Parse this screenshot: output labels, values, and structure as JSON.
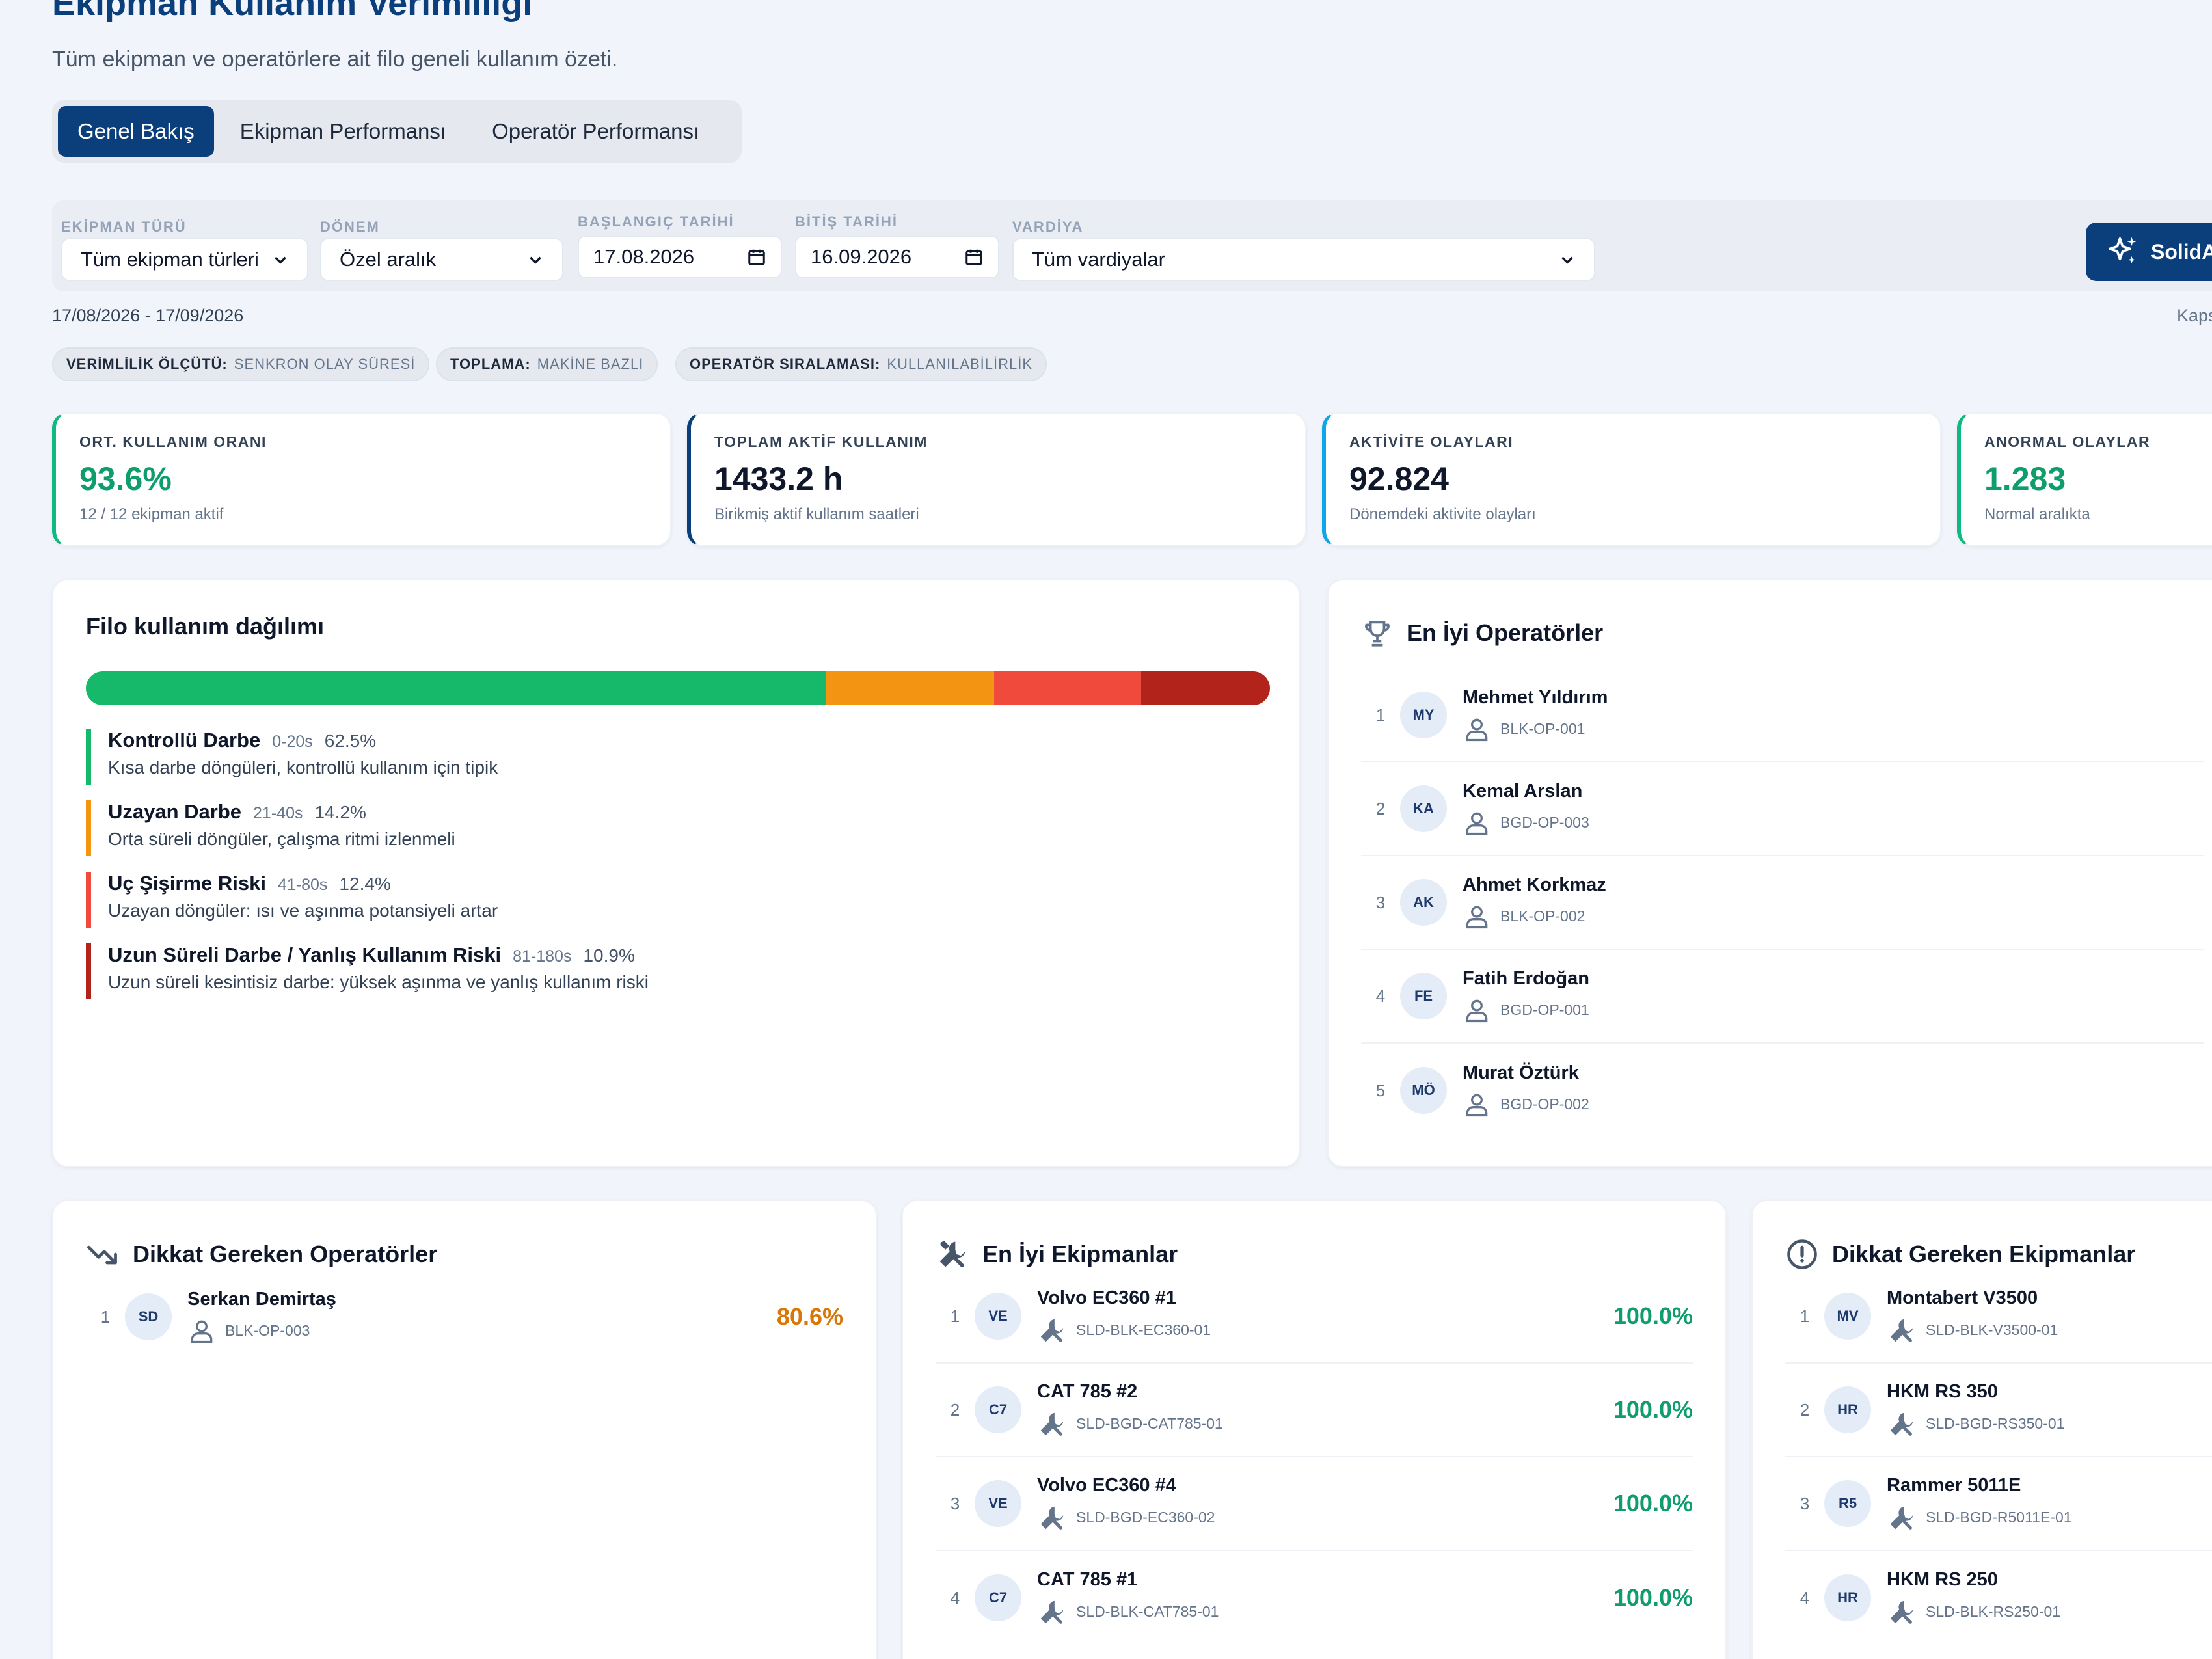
{
  "header": {
    "title": "Ekipman Kullanım Verimliliği",
    "subtitle": "Tüm ekipman ve operatörlere ait filo geneli kullanım özeti."
  },
  "tabs": [
    "Genel Bakış",
    "Ekipman Performansı",
    "Operatör Performansı"
  ],
  "filters": {
    "equipment_type": {
      "label": "EKİPMAN TÜRÜ",
      "value": "Tüm ekipman türleri"
    },
    "period": {
      "label": "DÖNEM",
      "value": "Özel aralık"
    },
    "start_date": {
      "label": "BAŞLANGIÇ TARİHİ",
      "value": "17.08.2026"
    },
    "end_date": {
      "label": "BİTİŞ TARİHİ",
      "value": "16.09.2026"
    },
    "shift": {
      "label": "VARDİYA",
      "value": "Tüm vardiyalar"
    },
    "ai_button": "SolidA"
  },
  "date_range": "17/08/2026 - 17/09/2026",
  "kaps_text": "Kaps",
  "chips": [
    {
      "key": "VERİMLİLİK ÖLÇÜTÜ:",
      "value": "SENKRON OLAY SÜRESİ"
    },
    {
      "key": "TOPLAMA:",
      "value": "MAKİNE BAZLI"
    },
    {
      "key": "OPERATÖR SIRALAMASI:",
      "value": "KULLANILABİLİRLİK"
    }
  ],
  "kpis": [
    {
      "label": "ORT. KULLANIM ORANI",
      "value": "93.6%",
      "sub": "12 / 12 ekipman aktif",
      "color": "#0f9d6b",
      "border": "#10b981"
    },
    {
      "label": "TOPLAM AKTİF KULLANIM",
      "value": "1433.2 h",
      "sub": "Birikmiş aktif kullanım saatleri",
      "color": "#0f172a",
      "border": "#0b3f7c"
    },
    {
      "label": "AKTİVİTE OLAYLARI",
      "value": "92.824",
      "sub": "Dönemdeki aktivite olayları",
      "color": "#0f172a",
      "border": "#0ea5e9"
    },
    {
      "label": "ANORMAL OLAYLAR",
      "value": "1.283",
      "sub": "Normal aralıkta",
      "color": "#0f9d6b",
      "border": "#10b981"
    }
  ],
  "distribution": {
    "title": "Filo kullanım dağılımı",
    "segments": [
      {
        "name": "Kontrollü Darbe",
        "range": "0-20s",
        "percent": "62.5%",
        "share": 62.5,
        "color": "#16b86a",
        "desc": "Kısa darbe döngüleri, kontrollü kullanım için tipik"
      },
      {
        "name": "Uzayan Darbe",
        "range": "21-40s",
        "percent": "14.2%",
        "share": 14.2,
        "color": "#f39412",
        "desc": "Orta süreli döngüler, çalışma ritmi izlenmeli"
      },
      {
        "name": "Uç Şişirme Riski",
        "range": "41-80s",
        "percent": "12.4%",
        "share": 12.4,
        "color": "#ef4a3c",
        "desc": "Uzayan döngüler: ısı ve aşınma potansiyeli artar"
      },
      {
        "name": "Uzun Süreli Darbe / Yanlış Kullanım Riski",
        "range": "81-180s",
        "percent": "10.9%",
        "share": 10.9,
        "color": "#b2231c",
        "desc": "Uzun süreli kesintisiz darbe: yüksek aşınma ve yanlış kullanım riski"
      }
    ]
  },
  "top_operators": {
    "title": "En İyi Operatörler",
    "items": [
      {
        "rank": "1",
        "initials": "MY",
        "name": "Mehmet Yıldırım",
        "code": "BLK-OP-001"
      },
      {
        "rank": "2",
        "initials": "KA",
        "name": "Kemal Arslan",
        "code": "BGD-OP-003"
      },
      {
        "rank": "3",
        "initials": "AK",
        "name": "Ahmet Korkmaz",
        "code": "BLK-OP-002"
      },
      {
        "rank": "4",
        "initials": "FE",
        "name": "Fatih Erdoğan",
        "code": "BGD-OP-001"
      },
      {
        "rank": "5",
        "initials": "MÖ",
        "name": "Murat Öztürk",
        "code": "BGD-OP-002"
      }
    ]
  },
  "attention_operators": {
    "title": "Dikkat Gereken Operatörler",
    "items": [
      {
        "rank": "1",
        "initials": "SD",
        "name": "Serkan Demirtaş",
        "code": "BLK-OP-003",
        "percent": "80.6%"
      }
    ]
  },
  "top_equipment": {
    "title": "En İyi Ekipmanlar",
    "items": [
      {
        "rank": "1",
        "initials": "VE",
        "name": "Volvo EC360 #1",
        "code": "SLD-BLK-EC360-01",
        "percent": "100.0%"
      },
      {
        "rank": "2",
        "initials": "C7",
        "name": "CAT 785 #2",
        "code": "SLD-BGD-CAT785-01",
        "percent": "100.0%"
      },
      {
        "rank": "3",
        "initials": "VE",
        "name": "Volvo EC360 #4",
        "code": "SLD-BGD-EC360-02",
        "percent": "100.0%"
      },
      {
        "rank": "4",
        "initials": "C7",
        "name": "CAT 785 #1",
        "code": "SLD-BLK-CAT785-01",
        "percent": "100.0%"
      }
    ]
  },
  "attention_equipment": {
    "title": "Dikkat Gereken Ekipmanlar",
    "items": [
      {
        "rank": "1",
        "initials": "MV",
        "name": "Montabert V3500",
        "code": "SLD-BLK-V3500-01"
      },
      {
        "rank": "2",
        "initials": "HR",
        "name": "HKM RS 350",
        "code": "SLD-BGD-RS350-01"
      },
      {
        "rank": "3",
        "initials": "R5",
        "name": "Rammer 5011E",
        "code": "SLD-BGD-R5011E-01"
      },
      {
        "rank": "4",
        "initials": "HR",
        "name": "HKM RS 250",
        "code": "SLD-BLK-RS250-01"
      }
    ]
  },
  "colors": {
    "brand": "#0b3f7c",
    "success": "#0f9d6b",
    "warning": "#d97706"
  }
}
